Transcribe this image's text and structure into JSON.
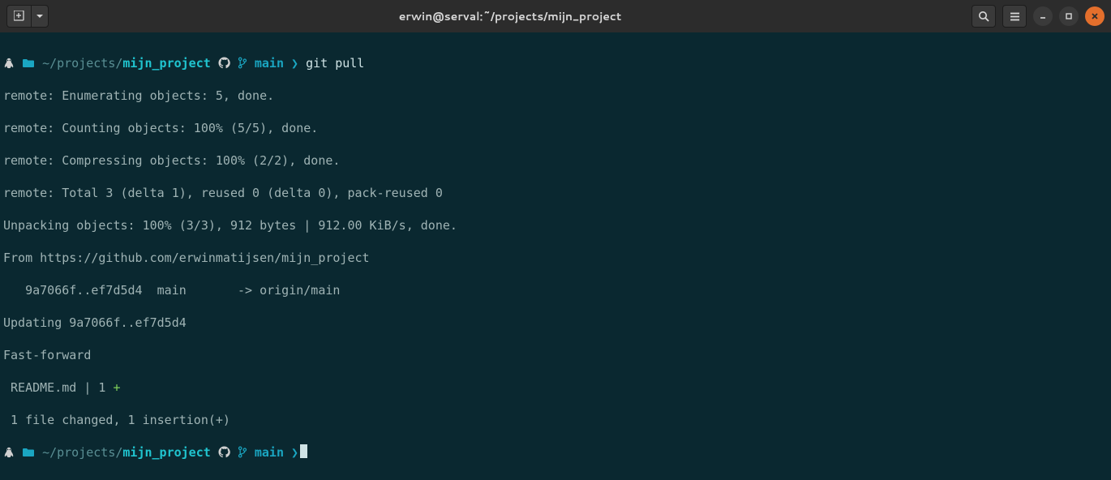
{
  "titlebar": {
    "title": "erwin@serval:~/projects/mijn_project"
  },
  "prompt1": {
    "penguin": "🐧",
    "path_prefix": "~/projects/",
    "path_leaf": "mijn_project",
    "branch": "main",
    "arrow": "❯",
    "command": "git pull"
  },
  "output": {
    "l1": "remote: Enumerating objects: 5, done.",
    "l2": "remote: Counting objects: 100% (5/5), done.",
    "l3": "remote: Compressing objects: 100% (2/2), done.",
    "l4": "remote: Total 3 (delta 1), reused 0 (delta 0), pack-reused 0",
    "l5": "Unpacking objects: 100% (3/3), 912 bytes | 912.00 KiB/s, done.",
    "l6": "From https://github.com/erwinmatijsen/mijn_project",
    "l7": "   9a7066f..ef7d5d4  main       -> origin/main",
    "l8": "Updating 9a7066f..ef7d5d4",
    "l9": "Fast-forward",
    "l10_a": " README.md | 1 ",
    "l10_b": "+",
    "l11": " 1 file changed, 1 insertion(+)"
  },
  "prompt2": {
    "penguin": "🐧",
    "path_prefix": "~/projects/",
    "path_leaf": "mijn_project",
    "branch": "main",
    "arrow": "❯"
  },
  "colors": {
    "bg": "#0a2830",
    "titlebar": "#2c2c2c",
    "accent": "#20c4cf",
    "close": "#e46f2c",
    "green": "#7fd05a"
  }
}
